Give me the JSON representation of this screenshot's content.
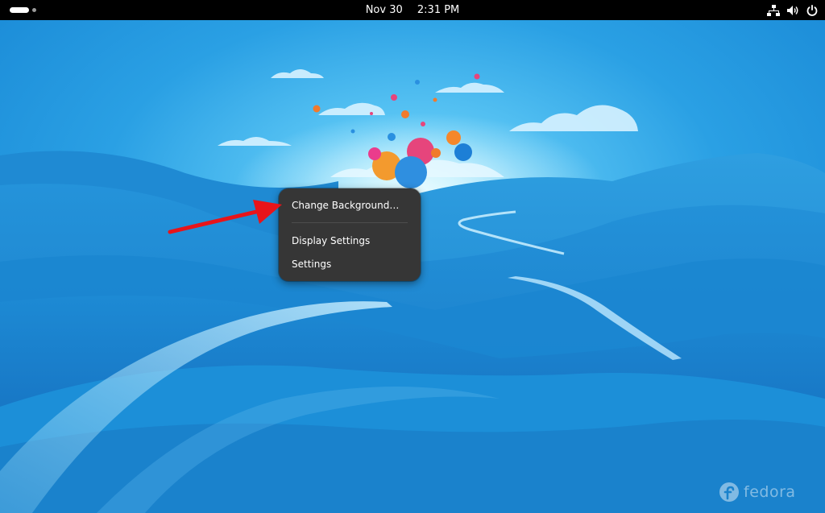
{
  "topbar": {
    "date": "Nov 30",
    "time": "2:31 PM",
    "tray_icons": [
      "network-wired-icon",
      "volume-icon",
      "power-icon"
    ]
  },
  "context_menu": {
    "items": [
      {
        "label": "Change Background…"
      },
      {
        "label": "Display Settings"
      },
      {
        "label": "Settings"
      }
    ]
  },
  "annotation": {
    "color": "#e8141a"
  },
  "branding": {
    "wordmark": "fedora"
  },
  "colors": {
    "topbar_bg": "#000000",
    "menu_bg": "#363636",
    "sky": "#33a6e6",
    "hills": "#1e86d0"
  }
}
